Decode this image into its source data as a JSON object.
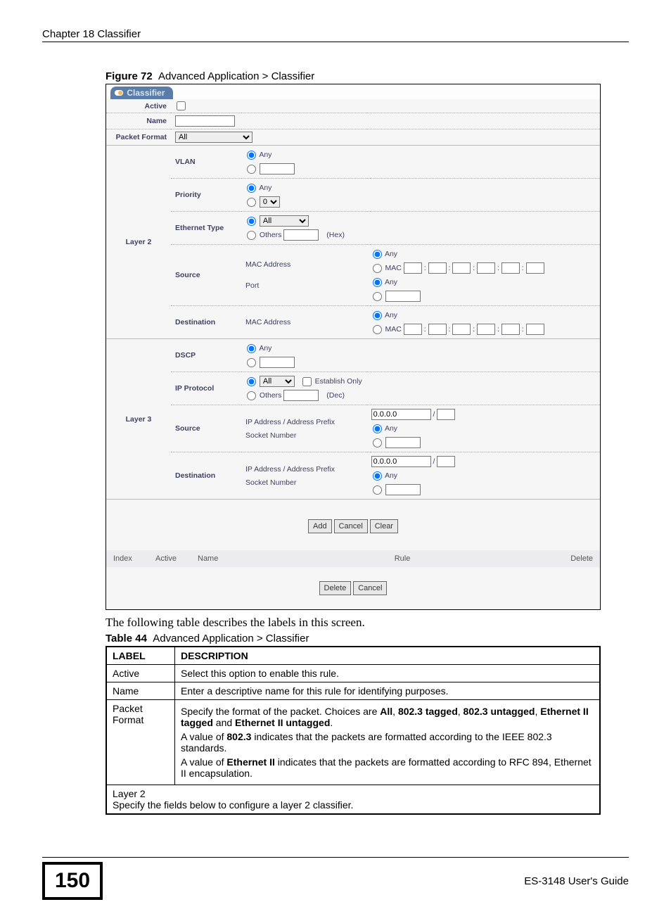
{
  "page_header": "Chapter 18 Classifier",
  "figure_caption_b": "Figure 72",
  "figure_caption": "Advanced Application > Classifier",
  "tab_title": "Classifier",
  "form": {
    "active_label": "Active",
    "name_label": "Name",
    "packet_format_label": "Packet Format",
    "packet_format_value": "All",
    "layer2": {
      "title": "Layer 2",
      "vlan_label": "VLAN",
      "any": "Any",
      "priority_label": "Priority",
      "priority_value": "0",
      "eth_type_label": "Ethernet Type",
      "eth_all": "All",
      "others": "Others",
      "hex": "(Hex)",
      "source_label": "Source",
      "mac_addr": "MAC Address",
      "mac": "MAC",
      "port": "Port",
      "destination_label": "Destination"
    },
    "layer3": {
      "title": "Layer 3",
      "dscp_label": "DSCP",
      "any": "Any",
      "ipproto_label": "IP Protocol",
      "all": "All",
      "establish": "Establish Only",
      "others": "Others",
      "dec": "(Dec)",
      "source_label": "Source",
      "dest_label": "Destination",
      "ipaddr": "IP Address / Address Prefix",
      "ip_default": "0.0.0.0",
      "slash": "/",
      "socket": "Socket Number"
    },
    "btn_add": "Add",
    "btn_cancel": "Cancel",
    "btn_clear": "Clear",
    "btn_delete": "Delete",
    "list_headers": {
      "index": "Index",
      "active": "Active",
      "name": "Name",
      "rule": "Rule",
      "delete": "Delete"
    }
  },
  "body_text": "The following table describes the labels in this screen.",
  "table_caption_b": "Table 44",
  "table_caption": "Advanced Application > Classifier",
  "doc_table": {
    "h_label": "LABEL",
    "h_desc": "DESCRIPTION",
    "r1_l": "Active",
    "r1_d": "Select this option to enable this rule.",
    "r2_l": "Name",
    "r2_d": "Enter a descriptive name for this rule for identifying purposes.",
    "r3_l": "Packet Format",
    "r3_p1a": "Specify the format of the packet. Choices are ",
    "r3_b1": "All",
    "r3_c": ", ",
    "r3_b2": "802.3 tagged",
    "r3_b3": "802.3 untagged",
    "r3_b4": "Ethernet II tagged",
    "r3_and": " and ",
    "r3_b5": "Ethernet II untagged",
    "r3_dot": ".",
    "r3_p2a": "A value of ",
    "r3_p2b": "802.3",
    "r3_p2c": " indicates that the packets are formatted according to the IEEE 802.3 standards.",
    "r3_p3a": "A value of ",
    "r3_p3b": "Ethernet II",
    "r3_p3c": " indicates that the packets are formatted according to RFC 894, Ethernet II encapsulation.",
    "r4_l2": "Layer 2",
    "r4_d": "Specify the fields below to configure a layer 2 classifier."
  },
  "page_number": "150",
  "guide": "ES-3148 User's Guide"
}
